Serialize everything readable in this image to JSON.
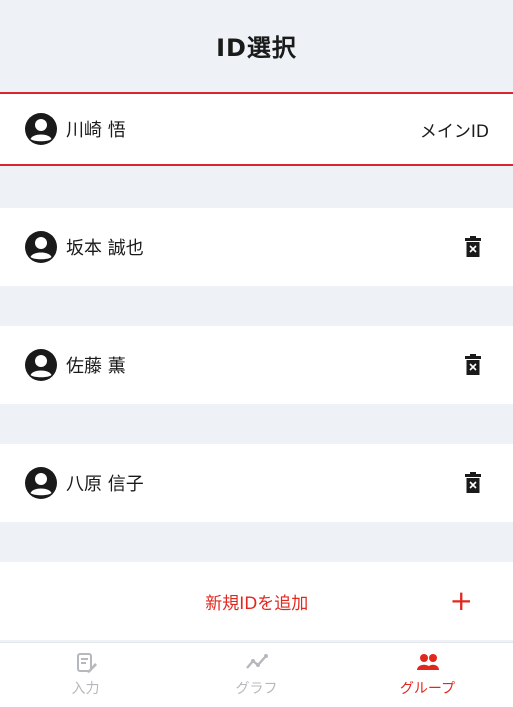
{
  "header": {
    "title": "ID選択"
  },
  "main_user": {
    "name": "川崎 悟",
    "tag": "メインID"
  },
  "users": [
    {
      "name": "坂本 誠也"
    },
    {
      "name": "佐藤 薫"
    },
    {
      "name": "八原 信子"
    }
  ],
  "add": {
    "label": "新規IDを追加",
    "plus": "+"
  },
  "tabs": [
    {
      "label": "入力",
      "icon": "input-icon"
    },
    {
      "label": "グラフ",
      "icon": "graph-icon"
    },
    {
      "label": "グループ",
      "icon": "group-icon",
      "active": true
    }
  ],
  "colors": {
    "accent": "#e1281f",
    "background": "#eef2f7",
    "inactive_tab": "#b5b8bd"
  }
}
